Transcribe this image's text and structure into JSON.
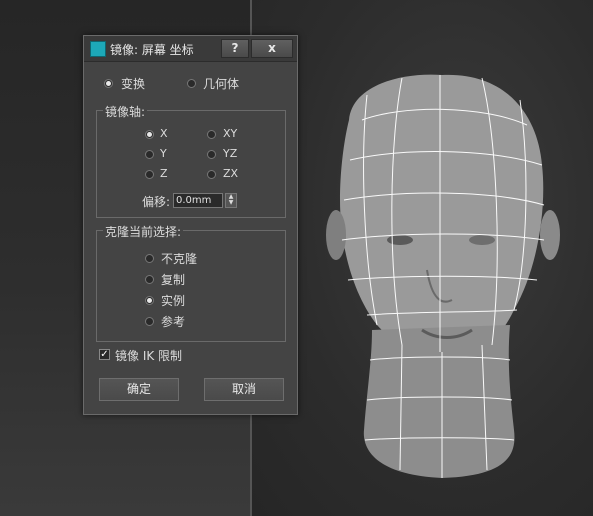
{
  "dialog": {
    "title": "镜像: 屏幕 坐标",
    "help_label": "?",
    "close_label": "x",
    "mode": {
      "transform": "变换",
      "geometry": "几何体",
      "selected": "transform"
    },
    "mirror_axis": {
      "group_title": "镜像轴:",
      "options": [
        "X",
        "Y",
        "Z",
        "XY",
        "YZ",
        "ZX"
      ],
      "selected": "X",
      "offset_label": "偏移:",
      "offset_value": "0.0mm"
    },
    "clone_selection": {
      "group_title": "克隆当前选择:",
      "options": [
        "不克隆",
        "复制",
        "实例",
        "参考"
      ],
      "selected": "实例"
    },
    "mirror_ik": {
      "label": "镜像 IK 限制",
      "checked": true
    },
    "ok_label": "确定",
    "cancel_label": "取消"
  },
  "colors": {
    "accent": "#1da8b8",
    "dialog_bg": "#444444",
    "wireframe": "#ffffff"
  },
  "icons": [
    "app-logo-icon",
    "help-icon",
    "close-icon",
    "checkmark-icon",
    "spinner-arrows-icon"
  ]
}
